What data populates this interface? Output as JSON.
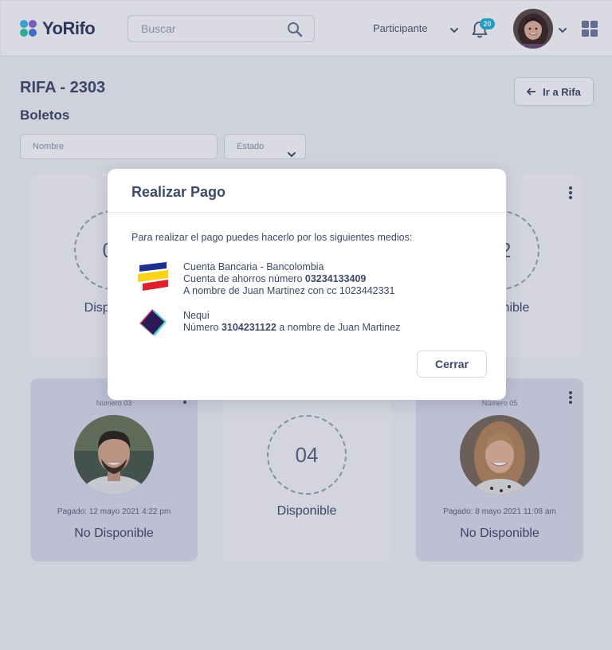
{
  "header": {
    "logo_text": "YoRifo",
    "search_placeholder": "Buscar",
    "role_label": "Participante",
    "notification_count": "20"
  },
  "page": {
    "title": "RIFA - 2303",
    "subtitle": "Boletos",
    "back_button": "Ir a Rifa"
  },
  "filters": {
    "name_placeholder": "Nombre",
    "state_label": "Estado"
  },
  "cards": [
    {
      "status": "Disponible",
      "number_display": "01"
    },
    {
      "status": "Disponible",
      "number_display": "02"
    },
    {
      "number_label": "Número 03",
      "paid": "Pagado: 12 mayo 2021 4:22 pm",
      "status": "No Disponible"
    },
    {
      "number_display": "04",
      "status": "Disponible"
    },
    {
      "number_label": "Número 05",
      "paid": "Pagado: 8 mayo 2021 11:08 am",
      "status": "No Disponible"
    }
  ],
  "modal": {
    "title": "Realizar Pago",
    "intro": "Para realizar el pago puedes hacerlo por los siguientes medios:",
    "bank": {
      "line1": "Cuenta Bancaria - Bancolombia",
      "line2_prefix": "Cuenta de ahorros número ",
      "account": "03234133409",
      "line3": "A nombre de Juan Martinez con cc 1023442331"
    },
    "nequi": {
      "line1": "Nequi",
      "line2_prefix": "Número ",
      "phone": "3104231122",
      "line2_suffix": " a nombre de Juan Martinez"
    },
    "close_button": "Cerrar"
  },
  "colors": {
    "accent": "#1bb7d6",
    "text": "#3c4a66"
  }
}
